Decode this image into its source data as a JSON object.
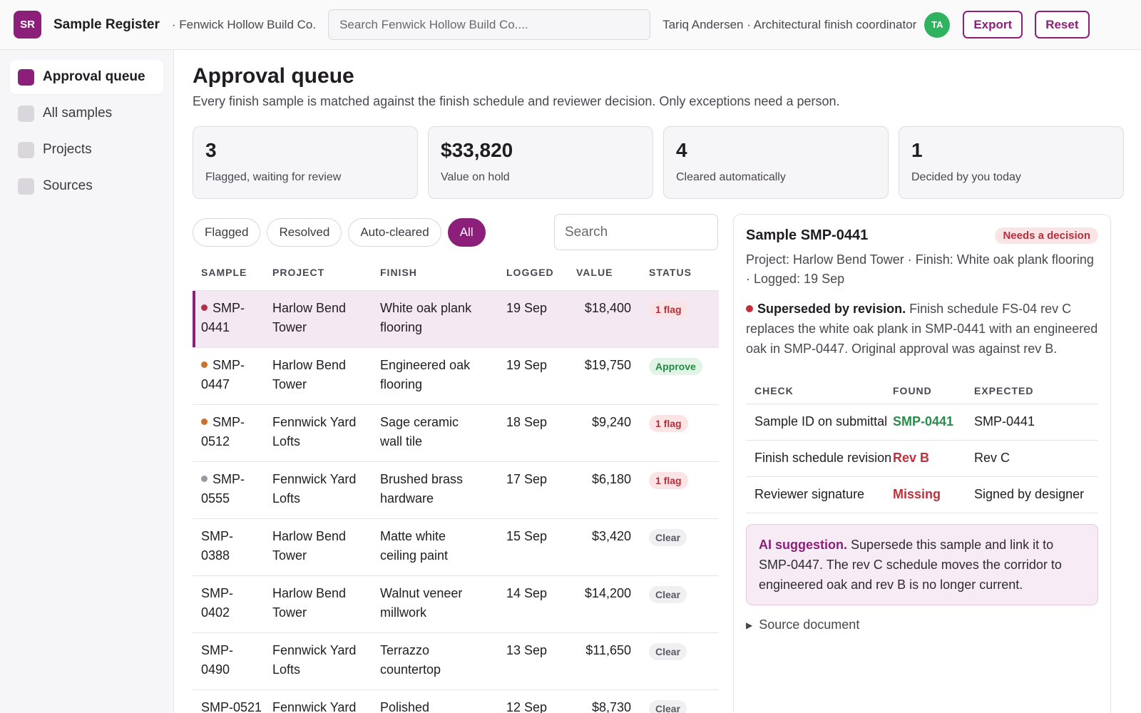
{
  "app": {
    "logo_text": "SR",
    "title": "Sample Register",
    "org": "· Fenwick Hollow Build Co.",
    "search_placeholder": "Search Fenwick Hollow Build Co....",
    "user": "Tariq Andersen · Architectural finish coordinator",
    "avatar_initials": "TA",
    "export_label": "Export",
    "reset_label": "Reset",
    "accent_color": "#8c1f7a"
  },
  "sidebar": {
    "items": [
      {
        "label": "Approval queue",
        "active": true
      },
      {
        "label": "All samples",
        "active": false
      },
      {
        "label": "Projects",
        "active": false
      },
      {
        "label": "Sources",
        "active": false
      }
    ]
  },
  "page": {
    "title": "Approval queue",
    "subtitle": "Every finish sample is matched against the finish schedule and reviewer decision. Only exceptions need a person."
  },
  "stats": [
    {
      "value": "3",
      "label": "Flagged, waiting for review"
    },
    {
      "value": "$33,820",
      "label": "Value on hold"
    },
    {
      "value": "4",
      "label": "Cleared automatically"
    },
    {
      "value": "1",
      "label": "Decided by you today"
    }
  ],
  "filters": {
    "chips": [
      "Flagged",
      "Resolved",
      "Auto-cleared",
      "All"
    ],
    "active": "All",
    "search_placeholder": "Search"
  },
  "table": {
    "headers": {
      "sample": "SAMPLE",
      "project": "PROJECT",
      "finish": "FINISH",
      "logged": "LOGGED",
      "value": "VALUE",
      "status": "STATUS"
    },
    "rows": [
      {
        "id": "SMP-0441",
        "id_l1": "SMP-",
        "id_l2": "0441",
        "dot": "#b3304f",
        "p1": "Harlow Bend",
        "p2": "Tower",
        "f1": "White oak plank",
        "f2": "flooring",
        "logged": "19 Sep",
        "value": "$18,400",
        "status": "1 flag",
        "status_type": "flag",
        "selected": true
      },
      {
        "id": "SMP-0447",
        "id_l1": "SMP-",
        "id_l2": "0447",
        "dot": "#c9722a",
        "p1": "Harlow Bend",
        "p2": "Tower",
        "f1": "Engineered oak",
        "f2": "flooring",
        "logged": "19 Sep",
        "value": "$19,750",
        "status": "Approve",
        "status_type": "approve",
        "selected": false
      },
      {
        "id": "SMP-0512",
        "id_l1": "SMP-",
        "id_l2": "0512",
        "dot": "#c9722a",
        "p1": "Fennwick Yard",
        "p2": "Lofts",
        "f1": "Sage ceramic",
        "f2": "wall tile",
        "logged": "18 Sep",
        "value": "$9,240",
        "status": "1 flag",
        "status_type": "flag",
        "selected": false
      },
      {
        "id": "SMP-0555",
        "id_l1": "SMP-",
        "id_l2": "0555",
        "dot": "#9a97a0",
        "p1": "Fennwick Yard",
        "p2": "Lofts",
        "f1": "Brushed brass",
        "f2": "hardware",
        "logged": "17 Sep",
        "value": "$6,180",
        "status": "1 flag",
        "status_type": "flag",
        "selected": false
      },
      {
        "id": "SMP-0388",
        "id_l1": "SMP-",
        "id_l2": "0388",
        "dot": "",
        "p1": "Harlow Bend",
        "p2": "Tower",
        "f1": "Matte white",
        "f2": "ceiling paint",
        "logged": "15 Sep",
        "value": "$3,420",
        "status": "Clear",
        "status_type": "clear",
        "selected": false
      },
      {
        "id": "SMP-0402",
        "id_l1": "SMP-",
        "id_l2": "0402",
        "dot": "",
        "p1": "Harlow Bend",
        "p2": "Tower",
        "f1": "Walnut veneer",
        "f2": "millwork",
        "logged": "14 Sep",
        "value": "$14,200",
        "status": "Clear",
        "status_type": "clear",
        "selected": false
      },
      {
        "id": "SMP-0490",
        "id_l1": "SMP-",
        "id_l2": "0490",
        "dot": "",
        "p1": "Fennwick Yard",
        "p2": "Lofts",
        "f1": "Terrazzo",
        "f2": "countertop",
        "logged": "13 Sep",
        "value": "$11,650",
        "status": "Clear",
        "status_type": "clear",
        "selected": false
      },
      {
        "id": "SMP-0521",
        "id_l1": "SMP-0521",
        "id_l2": "",
        "dot": "",
        "p1": "Fennwick Yard",
        "p2": "",
        "f1": "Polished",
        "f2": "",
        "logged": "12 Sep",
        "value": "$8,730",
        "status": "Clear",
        "status_type": "clear",
        "selected": false
      }
    ]
  },
  "detail": {
    "title": "Sample SMP-0441",
    "badge": "Needs a decision",
    "meta": "Project: Harlow Bend Tower · Finish: White oak plank flooring · Logged: 19 Sep",
    "reason_title": "Superseded by revision.",
    "reason_text": " Finish schedule FS-04 rev C replaces the white oak plank in SMP-0441 with an engineered oak in SMP-0447. Original approval was against rev B.",
    "checks_headers": {
      "check": "CHECK",
      "found": "FOUND",
      "expected": "EXPECTED"
    },
    "checks": [
      {
        "check": "Sample ID on submittal",
        "found": "SMP-0441",
        "expected": "SMP-0441",
        "ok": true
      },
      {
        "check": "Finish schedule revision",
        "found": "Rev B",
        "expected": "Rev C",
        "ok": false
      },
      {
        "check": "Reviewer signature",
        "found": "Missing",
        "expected": "Signed by designer",
        "ok": false
      }
    ],
    "ai_label": "AI suggestion.",
    "ai_text": " Supersede this sample and link it to SMP-0447. The rev C schedule moves the corridor to engineered oak and rev B is no longer current.",
    "source_label": "Source document"
  }
}
